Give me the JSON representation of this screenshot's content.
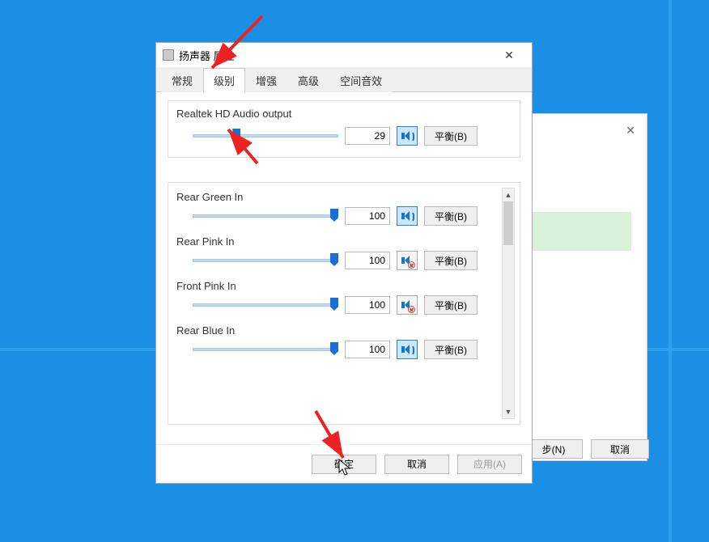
{
  "window": {
    "title": "扬声器 属性",
    "close_label": "✕"
  },
  "tabs": [
    {
      "label": "常规",
      "active": false
    },
    {
      "label": "级别",
      "active": true
    },
    {
      "label": "增强",
      "active": false
    },
    {
      "label": "高级",
      "active": false
    },
    {
      "label": "空间音效",
      "active": false
    }
  ],
  "main_output": {
    "label": "Realtek HD Audio output",
    "value": "29",
    "percent": 29,
    "muted": false,
    "balance_label": "平衡(B)"
  },
  "channels": [
    {
      "name": "Rear Green In",
      "value": "100",
      "percent": 100,
      "muted": false,
      "balance_label": "平衡(B)"
    },
    {
      "name": "Rear Pink In",
      "value": "100",
      "percent": 100,
      "muted": true,
      "balance_label": "平衡(B)"
    },
    {
      "name": "Front Pink In",
      "value": "100",
      "percent": 100,
      "muted": true,
      "balance_label": "平衡(B)"
    },
    {
      "name": "Rear Blue In",
      "value": "100",
      "percent": 100,
      "muted": false,
      "balance_label": "平衡(B)"
    }
  ],
  "footer": {
    "ok": "确定",
    "cancel": "取消",
    "apply": "应用(A)"
  },
  "behind": {
    "close_label": "✕",
    "next": "步(N)",
    "cancel": "取消"
  }
}
